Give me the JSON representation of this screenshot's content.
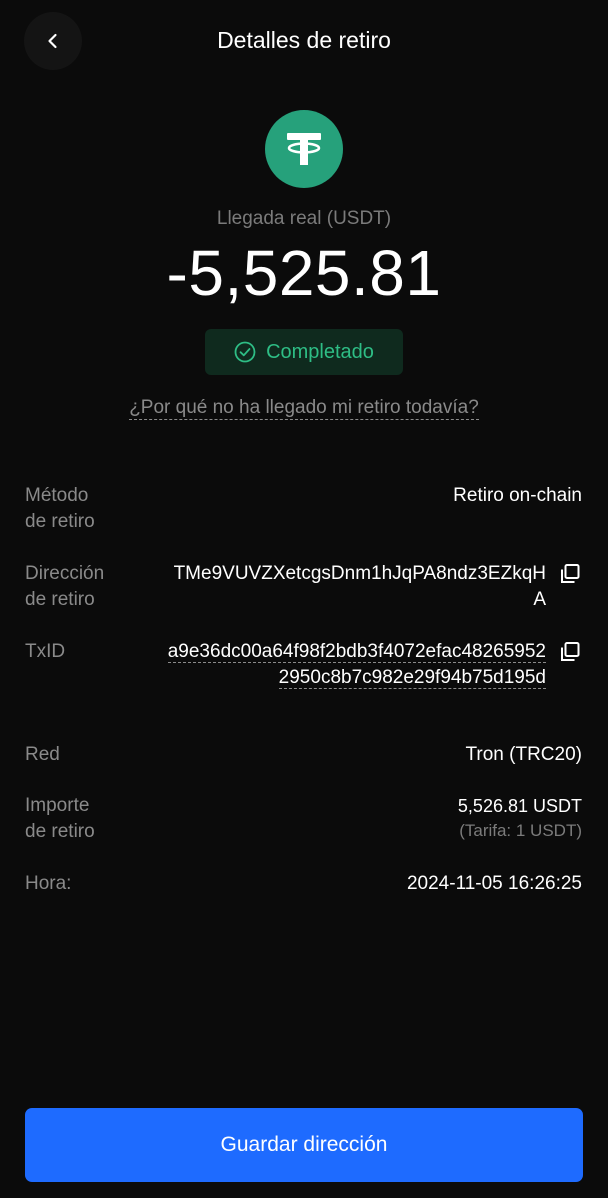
{
  "header": {
    "title": "Detalles de retiro"
  },
  "amount": {
    "label": "Llegada real (USDT)",
    "value": "-5,525.81"
  },
  "status": {
    "label": "Completado",
    "color": "#2ebd85"
  },
  "help_link": "¿Por qué no ha llegado mi retiro todavía?",
  "details": {
    "method": {
      "label_1": "Método",
      "label_2": "de retiro",
      "value": "Retiro on-chain"
    },
    "address": {
      "label_1": "Dirección",
      "label_2": "de retiro",
      "value": "TMe9VUVZXetcgsDnm1hJqPA8ndz3EZkqHA"
    },
    "txid": {
      "label": "TxID",
      "value": "a9e36dc00a64f98f2bdb3f4072efac482659522950c8b7c982e29f94b75d195d"
    },
    "network": {
      "label": "Red",
      "value": "Tron (TRC20)"
    },
    "amount": {
      "label_1": "Importe",
      "label_2": "de retiro",
      "value": "5,526.81 USDT",
      "fee": "(Tarifa: 1 USDT)"
    },
    "time": {
      "label": "Hora:",
      "value": "2024-11-05 16:26:25"
    }
  },
  "save_button": "Guardar dirección",
  "colors": {
    "accent": "#1e6bff",
    "coin": "#26a17b",
    "background": "#0b0b0b"
  },
  "icons": {
    "back": "chevron-left-icon",
    "coin": "tether-icon",
    "status": "check-circle-icon",
    "copy": "copy-icon"
  }
}
